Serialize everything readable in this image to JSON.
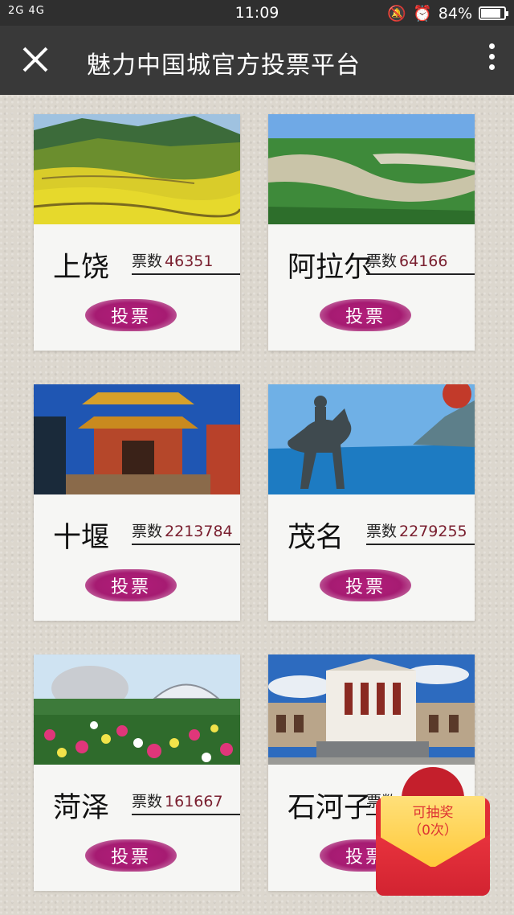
{
  "status_bar": {
    "signal": "2G 4G",
    "time": "11:09",
    "battery": "84%",
    "battery_level": 0.84
  },
  "nav": {
    "title": "魅力中国城官方投票平台"
  },
  "cards": [
    {
      "city": "上饶",
      "votes_label": "票数",
      "votes": "46351",
      "button": "投票"
    },
    {
      "city": "阿拉尔",
      "votes_label": "票数",
      "votes": "64166",
      "button": "投票"
    },
    {
      "city": "十堰",
      "votes_label": "票数",
      "votes": "2213784",
      "button": "投票"
    },
    {
      "city": "茂名",
      "votes_label": "票数",
      "votes": "2279255",
      "button": "投票"
    },
    {
      "city": "菏泽",
      "votes_label": "票数",
      "votes": "161667",
      "button": "投票"
    },
    {
      "city": "石河子",
      "votes_label": "票数",
      "votes": "",
      "button": "投票"
    }
  ],
  "lottery": {
    "label": "可抽奖",
    "count": "（0次）"
  },
  "colors": {
    "vote_button": "#a61b72",
    "nav_bg": "#393939",
    "vote_number": "#7a2030"
  }
}
